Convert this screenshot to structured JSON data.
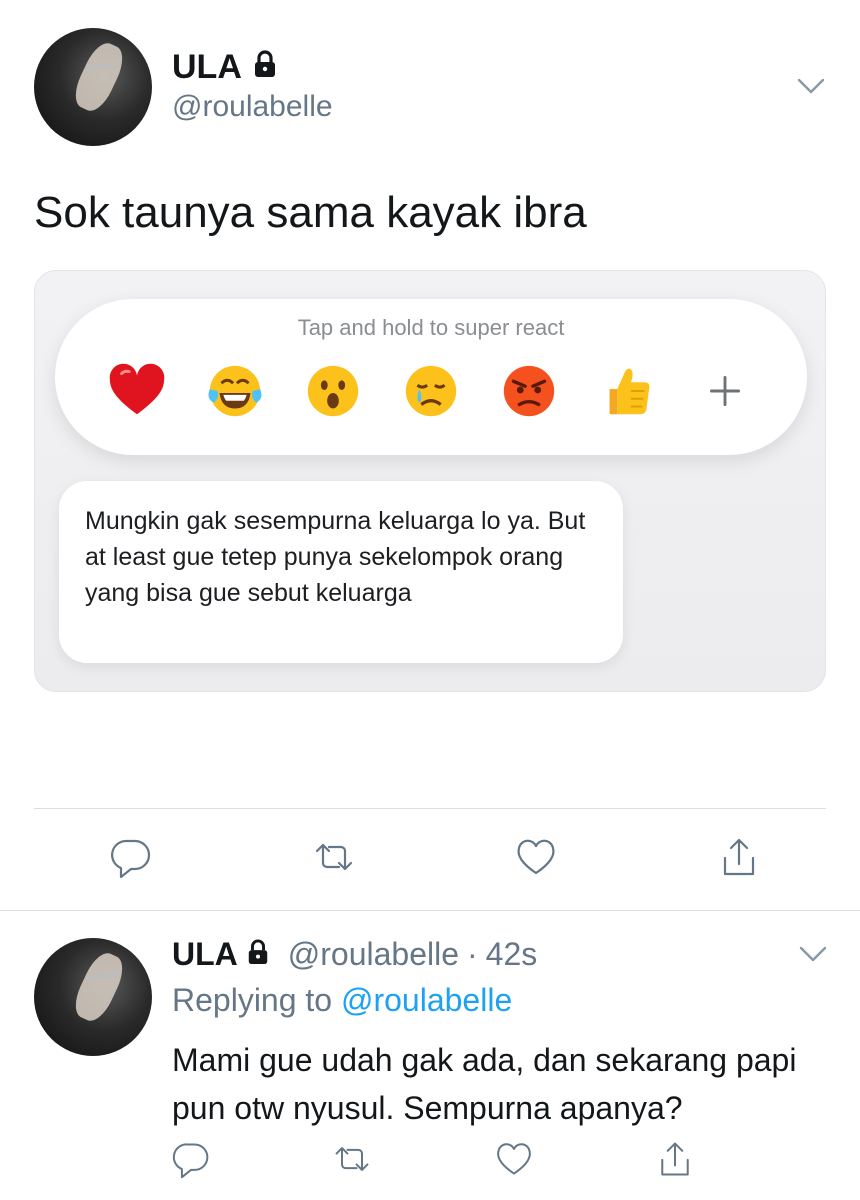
{
  "tweet": {
    "author_name": "ULA",
    "handle": "@roulabelle",
    "lock_icon": "lock-icon",
    "text": "Sok taunya sama kayak ibra",
    "media": {
      "hint": "Tap and hold to super react",
      "reactions": [
        "heart",
        "tears-of-joy",
        "surprised",
        "crying",
        "angry",
        "thumbs-up",
        "plus"
      ],
      "message": "Mungkin gak sesempurna keluarga lo ya. But at least gue tetep punya sekelompok orang yang bisa gue sebut keluarga"
    },
    "actions": [
      "reply-icon",
      "retweet-icon",
      "like-icon",
      "share-icon"
    ]
  },
  "reply": {
    "author_name": "ULA",
    "handle": "@roulabelle",
    "separator": "·",
    "time": "42s",
    "replying_prefix": "Replying to",
    "replying_to": "@roulabelle",
    "text": "Mami gue udah gak ada, dan sekarang papi pun otw nyusul. Sempurna apanya?",
    "actions": [
      "reply-icon",
      "retweet-icon",
      "like-icon",
      "share-icon"
    ]
  },
  "colors": {
    "text": "#14171a",
    "secondary": "#657786",
    "link": "#1da1f2",
    "divider": "#dadde1"
  }
}
